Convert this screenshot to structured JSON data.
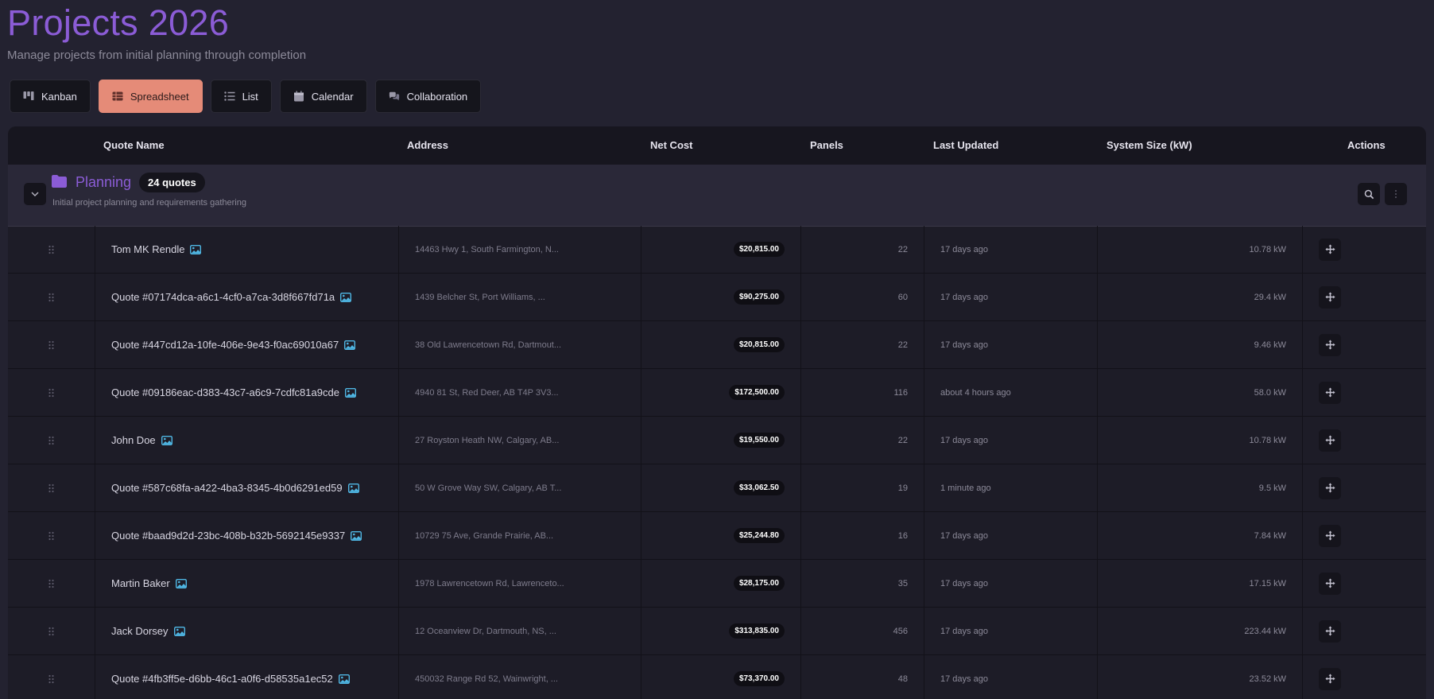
{
  "page": {
    "title": "Projects 2026",
    "subtitle": "Manage projects from initial planning through completion"
  },
  "tabs": [
    {
      "label": "Kanban",
      "icon": "kanban-icon",
      "active": false
    },
    {
      "label": "Spreadsheet",
      "icon": "spreadsheet-icon",
      "active": true
    },
    {
      "label": "List",
      "icon": "list-icon",
      "active": false
    },
    {
      "label": "Calendar",
      "icon": "calendar-icon",
      "active": false
    },
    {
      "label": "Collaboration",
      "icon": "collaboration-icon",
      "active": false
    }
  ],
  "columns": {
    "quote_name": "Quote Name",
    "address": "Address",
    "net_cost": "Net Cost",
    "panels": "Panels",
    "last_updated": "Last Updated",
    "system_size": "System Size (kW)",
    "actions": "Actions"
  },
  "group": {
    "name": "Planning",
    "count": "24 quotes",
    "description": "Initial project planning and requirements gathering",
    "icon": "folder-icon"
  },
  "colors": {
    "accent": "#8b5cd6",
    "active_tab": "#e58b78",
    "image_icon": "#4fb6e3"
  },
  "rows": [
    {
      "name": "Tom MK Rendle",
      "address": "14463 Hwy 1, South Farmington, N...",
      "cost": "$20,815.00",
      "panels": "22",
      "updated": "17 days ago",
      "size": "10.78 kW"
    },
    {
      "name": "Quote #07174dca-a6c1-4cf0-a7ca-3d8f667fd71a",
      "address": "1439 Belcher St, Port Williams, ...",
      "cost": "$90,275.00",
      "panels": "60",
      "updated": "17 days ago",
      "size": "29.4 kW"
    },
    {
      "name": "Quote #447cd12a-10fe-406e-9e43-f0ac69010a67",
      "address": "38 Old Lawrencetown Rd, Dartmout...",
      "cost": "$20,815.00",
      "panels": "22",
      "updated": "17 days ago",
      "size": "9.46 kW"
    },
    {
      "name": "Quote #09186eac-d383-43c7-a6c9-7cdfc81a9cde",
      "address": "4940 81 St, Red Deer, AB T4P 3V3...",
      "cost": "$172,500.00",
      "panels": "116",
      "updated": "about 4 hours ago",
      "size": "58.0 kW"
    },
    {
      "name": "John Doe",
      "address": "27 Royston Heath NW, Calgary, AB...",
      "cost": "$19,550.00",
      "panels": "22",
      "updated": "17 days ago",
      "size": "10.78 kW"
    },
    {
      "name": "Quote #587c68fa-a422-4ba3-8345-4b0d6291ed59",
      "address": "50 W Grove Way SW, Calgary, AB T...",
      "cost": "$33,062.50",
      "panels": "19",
      "updated": "1 minute ago",
      "size": "9.5 kW"
    },
    {
      "name": "Quote #baad9d2d-23bc-408b-b32b-5692145e9337",
      "address": "10729 75 Ave, Grande Prairie, AB...",
      "cost": "$25,244.80",
      "panels": "16",
      "updated": "17 days ago",
      "size": "7.84 kW"
    },
    {
      "name": "Martin Baker",
      "address": "1978 Lawrencetown Rd, Lawrenceto...",
      "cost": "$28,175.00",
      "panels": "35",
      "updated": "17 days ago",
      "size": "17.15 kW"
    },
    {
      "name": "Jack Dorsey",
      "address": "12 Oceanview Dr, Dartmouth, NS, ...",
      "cost": "$313,835.00",
      "panels": "456",
      "updated": "17 days ago",
      "size": "223.44 kW"
    },
    {
      "name": "Quote #4fb3ff5e-d6bb-46c1-a0f6-d58535a1ec52",
      "address": "450032 Range Rd 52, Wainwright, ...",
      "cost": "$73,370.00",
      "panels": "48",
      "updated": "17 days ago",
      "size": "23.52 kW"
    }
  ]
}
